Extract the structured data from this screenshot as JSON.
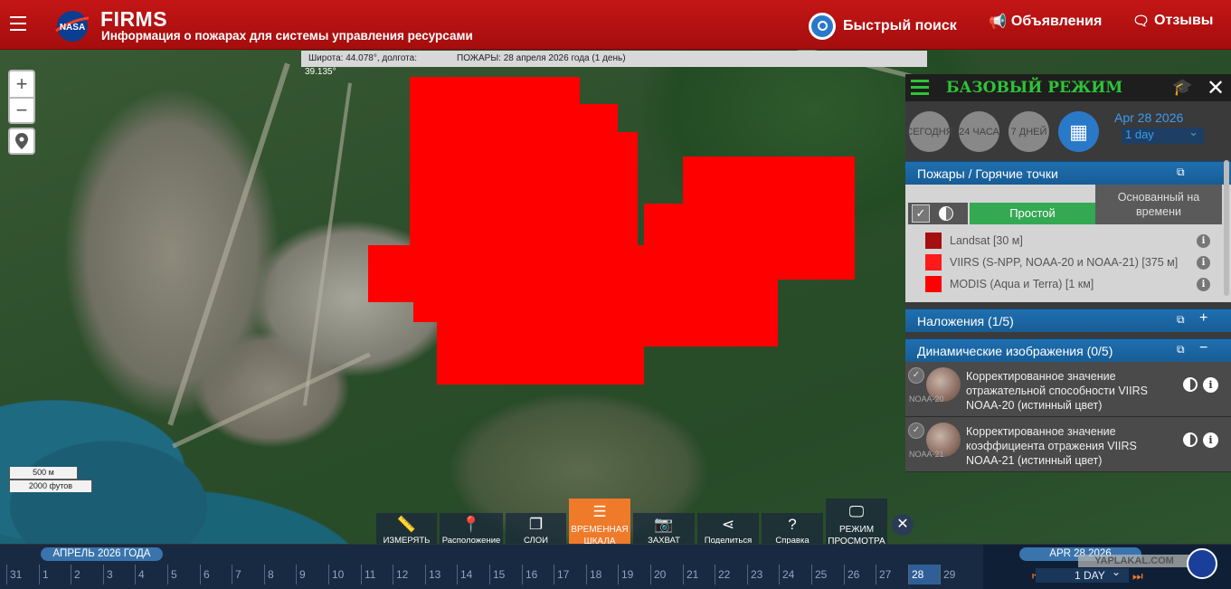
{
  "header": {
    "title": "FIRMS",
    "subtitle": "Информация о пожарах для системы управления ресурсами",
    "logo_text": "NASA",
    "quick_search": "Быстрый поиск",
    "announcements": "Объявления",
    "feedback": "Отзывы"
  },
  "coords": {
    "lat": "Широта: 44.078°, долгота:",
    "lon": "39.135°",
    "fires": "ПОЖАРЫ: 28 апреля 2026 года (1 день)"
  },
  "map_controls": {
    "zoom_in": "+",
    "zoom_out": "−"
  },
  "scale": {
    "meters": "500 м",
    "feet": "2000 футов"
  },
  "panel": {
    "mode": "БАЗОВЫЙ РЕЖИМ",
    "date_buttons": [
      {
        "label": "СЕГОДНЯ"
      },
      {
        "label": "24 ЧАСА"
      },
      {
        "label": "7 ДНЕЙ"
      }
    ],
    "date_value": "Apr 28 2026",
    "range_value": "1 day",
    "fires_section": "Пожары / Горячие точки",
    "style_simple": "Простой",
    "style_time": "Основанный на времени",
    "layers": [
      {
        "label": "Landsat [30 м]",
        "color": "#a50f0f"
      },
      {
        "label": "VIIRS (S-NPP, NOAA-20 и NOAA-21) [375 м]",
        "color": "#ff1a1a"
      },
      {
        "label": "MODIS (Aqua и Terra) [1 км]",
        "color": "#ff0000"
      }
    ],
    "overlays_section": "Наложения (1/5)",
    "dynamic_section": "Динамические изображения (0/5)",
    "dynamic_items": [
      {
        "title": "Корректированное значение отражательной способности VIIRS NOAA-20 (истинный цвет)",
        "sat": "NOAA-20"
      },
      {
        "title": "Корректированное значение коэффициента отражения VIIRS NOAA-21 (истинный цвет)",
        "sat": "NOAA-21"
      }
    ]
  },
  "toolbar": {
    "measure": "ИЗМЕРЯТЬ",
    "location": "Расположение",
    "layers": "СЛОИ",
    "timeline": "ВРЕМЕННАЯ ШКАЛА",
    "capture": "ЗАХВАТ",
    "share": "Поделиться",
    "help": "Справка",
    "present": "РЕЖИМ ПРОСМОТРА"
  },
  "timeline": {
    "month": "АПРЕЛЬ 2026 ГОДА",
    "days": [
      "31",
      "1",
      "2",
      "3",
      "4",
      "5",
      "6",
      "7",
      "8",
      "9",
      "10",
      "11",
      "12",
      "13",
      "14",
      "15",
      "16",
      "17",
      "18",
      "19",
      "20",
      "21",
      "22",
      "23",
      "24",
      "25",
      "26",
      "27",
      "28",
      "29"
    ],
    "selected_day": "28",
    "date": "APR 28 2026",
    "step": "1 DAY"
  },
  "watermark": "YAPLAKAL.COM"
}
